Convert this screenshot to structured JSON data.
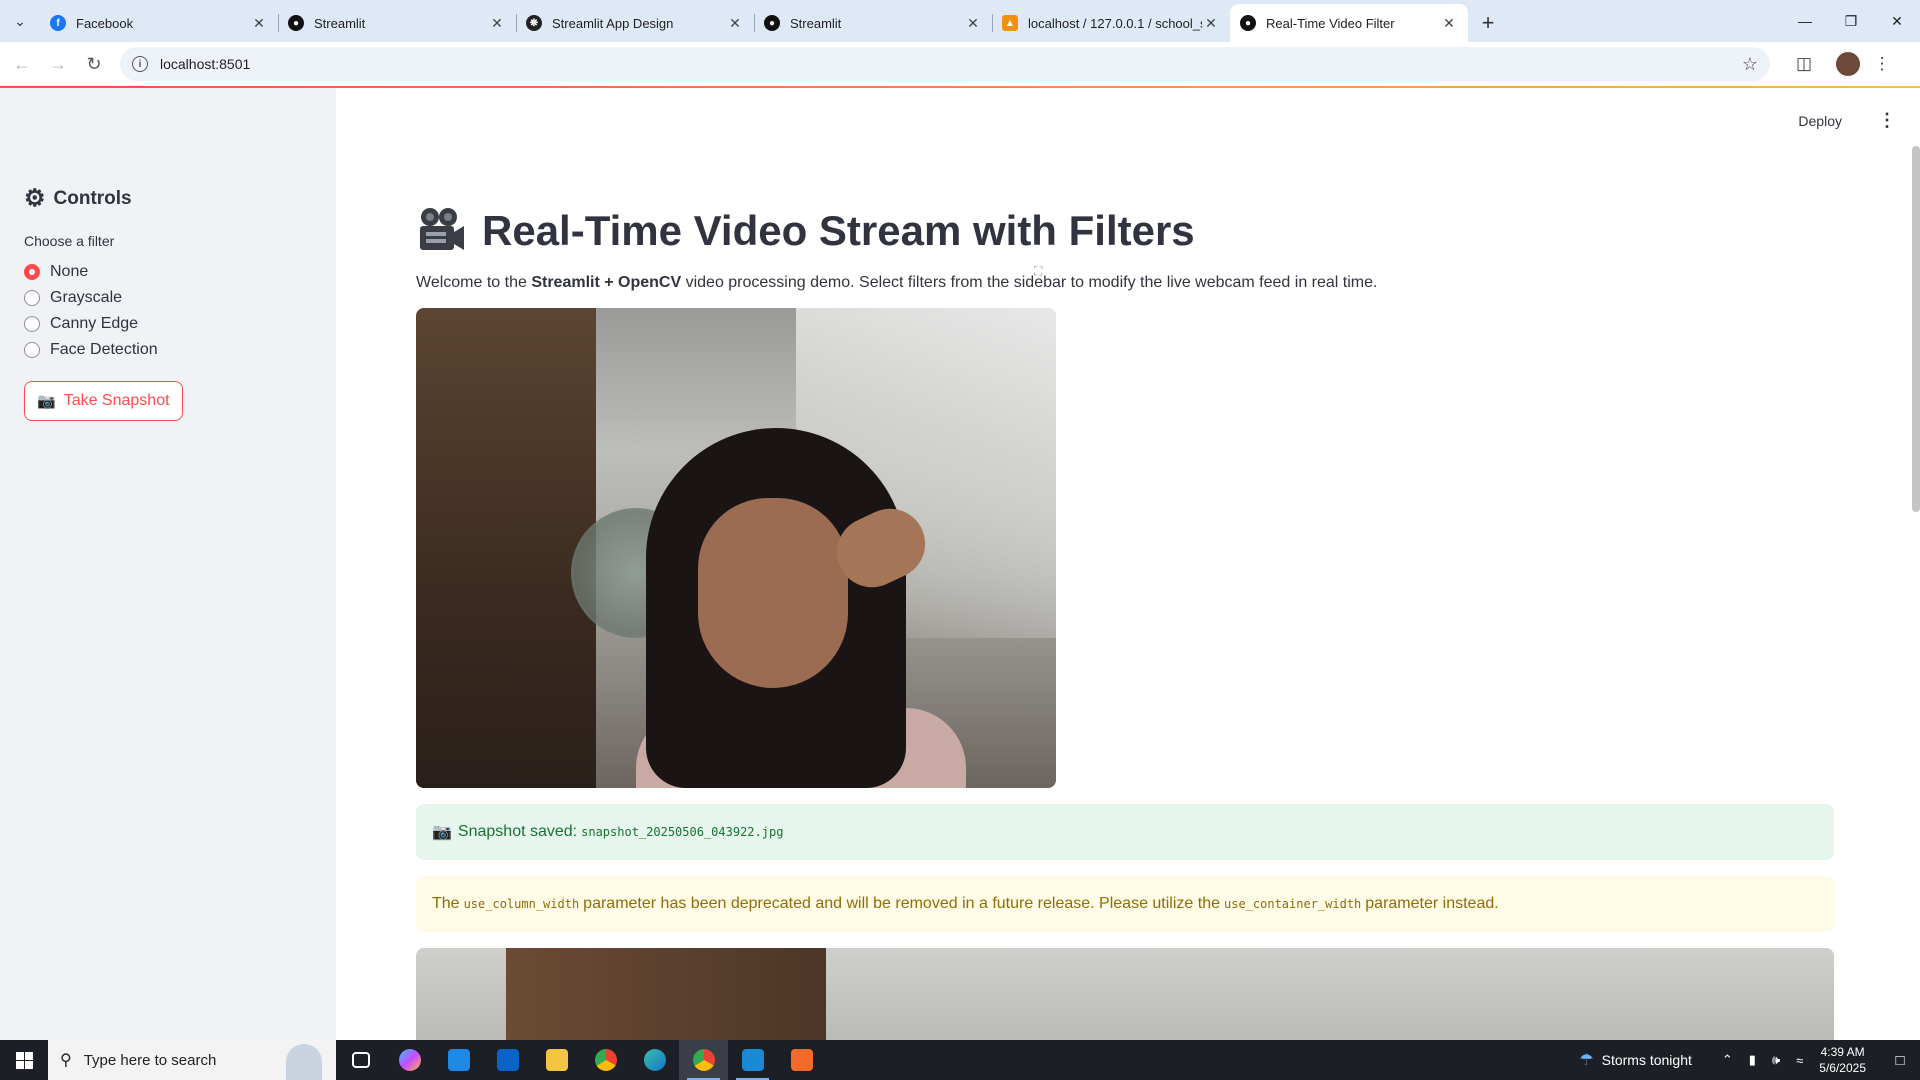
{
  "browser": {
    "tabs": [
      {
        "title": "Facebook",
        "icon": "facebook-icon",
        "color": "#1877f2",
        "active": false
      },
      {
        "title": "Streamlit",
        "icon": "streamlit-icon",
        "color": "#111111",
        "active": false
      },
      {
        "title": "Streamlit App Design",
        "icon": "openai-icon",
        "color": "#222222",
        "active": false
      },
      {
        "title": "Streamlit",
        "icon": "streamlit-icon",
        "color": "#111111",
        "active": false
      },
      {
        "title": "localhost / 127.0.0.1 / school_sy",
        "icon": "phpmyadmin-icon",
        "color": "#f29111",
        "active": false
      },
      {
        "title": "Real-Time Video Filter",
        "icon": "streamlit-icon",
        "color": "#111111",
        "active": true
      }
    ],
    "url": "localhost:8501"
  },
  "app": {
    "header": {
      "deploy_label": "Deploy"
    },
    "sidebar": {
      "title": "Controls",
      "filter_label": "Choose a filter",
      "options": [
        {
          "label": "None",
          "selected": true
        },
        {
          "label": "Grayscale",
          "selected": false
        },
        {
          "label": "Canny Edge",
          "selected": false
        },
        {
          "label": "Face Detection",
          "selected": false
        }
      ],
      "snapshot_button": "Take Snapshot"
    },
    "main": {
      "title": "Real-Time Video Stream with Filters",
      "intro_before": "Welcome to the ",
      "intro_bold": "Streamlit + OpenCV",
      "intro_after": " video processing demo. Select filters from the sidebar to modify the live webcam feed in real time.",
      "success_label": "Snapshot saved:",
      "success_file": "snapshot_20250506_043922.jpg",
      "warning_before": "The",
      "warning_code1": "use_column_width",
      "warning_mid": "parameter has been deprecated and will be removed in a future release. Please utilize the",
      "warning_code2": "use_container_width",
      "warning_after": "parameter instead."
    },
    "colors": {
      "accent": "#ff4b4b",
      "success_bg": "#e6f6ec",
      "warning_bg": "#fefbe6"
    }
  },
  "taskbar": {
    "search_placeholder": "Type here to search",
    "weather": "Storms tonight",
    "time": "4:39 AM",
    "date": "5/6/2025"
  }
}
